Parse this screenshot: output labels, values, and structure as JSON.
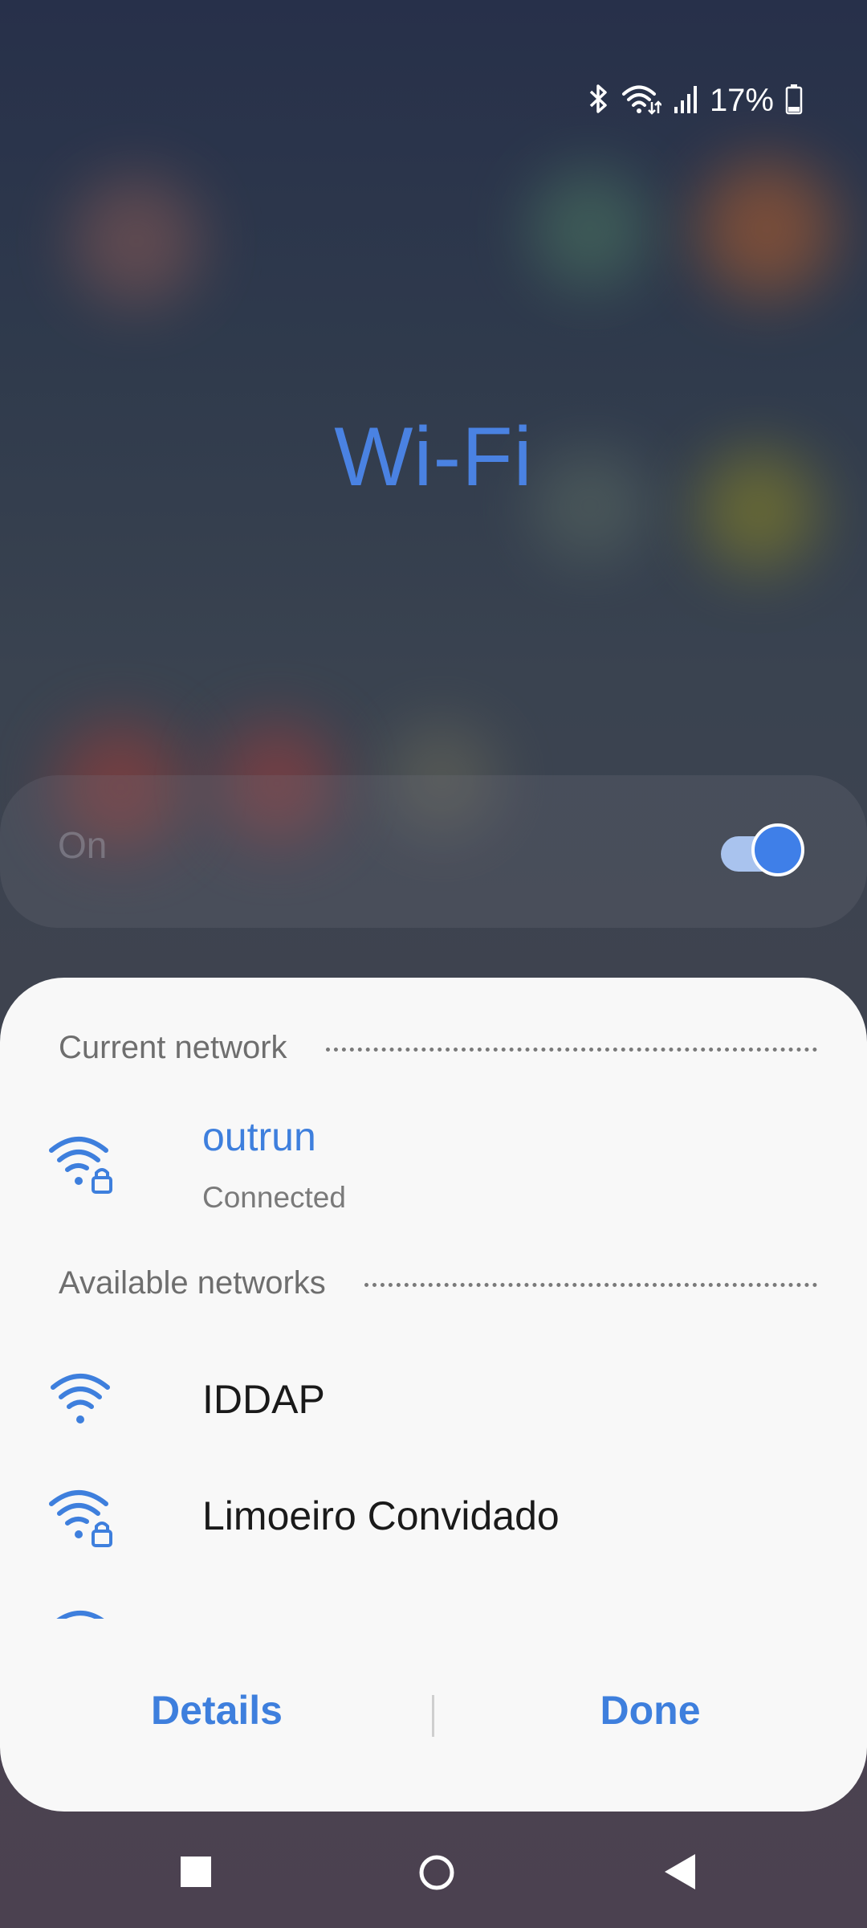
{
  "status_bar": {
    "battery_percent": "17%",
    "icons": [
      "bluetooth-icon",
      "wifi-data-icon",
      "signal-icon",
      "battery-icon"
    ]
  },
  "page": {
    "title": "Wi-Fi",
    "toggle_label": "On",
    "toggle_on": true
  },
  "sheet": {
    "current_section": "Current network",
    "current_network": {
      "name": "outrun",
      "status": "Connected",
      "icon": "wifi-lock-icon"
    },
    "available_section": "Available networks",
    "available_networks": [
      {
        "name": "IDDAP",
        "icon": "wifi-icon"
      },
      {
        "name": "Limoeiro Convidado",
        "icon": "wifi-lock-icon"
      }
    ],
    "details_label": "Details",
    "done_label": "Done"
  },
  "nav": {
    "icons": [
      "recents-icon",
      "home-icon",
      "back-icon"
    ]
  },
  "colors": {
    "accent": "#3e7fdd",
    "sheet_bg": "#f8f8f8"
  }
}
